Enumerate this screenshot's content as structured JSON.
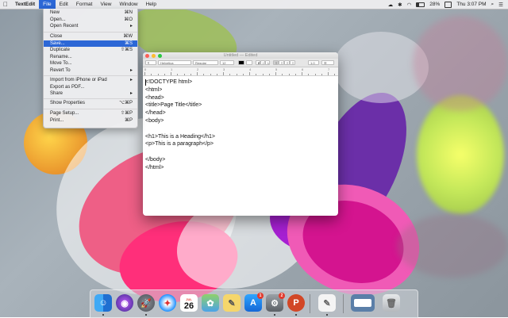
{
  "menubar": {
    "app_name": "TextEdit",
    "menus": [
      "File",
      "Edit",
      "Format",
      "View",
      "Window",
      "Help"
    ],
    "battery": "28%",
    "clock": "Thu 3:07 PM",
    "battery_level": 0.28
  },
  "file_menu": {
    "items": [
      {
        "label": "New",
        "shortcut": "⌘N"
      },
      {
        "label": "Open...",
        "shortcut": "⌘O"
      },
      {
        "label": "Open Recent",
        "shortcut": "▸"
      },
      {
        "label": "Close",
        "shortcut": "⌘W"
      },
      {
        "label": "Save...",
        "shortcut": "⌘S"
      },
      {
        "label": "Duplicate",
        "shortcut": "⇧⌘S"
      },
      {
        "label": "Rename...",
        "shortcut": ""
      },
      {
        "label": "Move To...",
        "shortcut": ""
      },
      {
        "label": "Revert To",
        "shortcut": "▸"
      },
      {
        "label": "Import from iPhone or iPad",
        "shortcut": "▸"
      },
      {
        "label": "Export as PDF...",
        "shortcut": ""
      },
      {
        "label": "Share",
        "shortcut": "▸"
      },
      {
        "label": "Show Properties",
        "shortcut": "⌥⌘P"
      },
      {
        "label": "Page Setup...",
        "shortcut": "⇧⌘P"
      },
      {
        "label": "Print...",
        "shortcut": "⌘P"
      }
    ]
  },
  "window": {
    "title": "Untitled",
    "edited": "— Edited",
    "toolbar": {
      "style": "¶",
      "font": "Helvetica",
      "weight": "Regular",
      "size": "12",
      "spacing": "1.0"
    },
    "ruler": [
      "0",
      "1",
      "2",
      "3",
      "4",
      "5",
      "6",
      "7"
    ],
    "lines": [
      "<!DOCTYPE html>",
      "<html>",
      "<head>",
      "<title>Page Title</title>",
      "</head>",
      "<body>",
      "",
      "<h1>This is a Heading</h1>",
      "<p>This is a paragraph</p>",
      "",
      "</body>",
      "</html>"
    ]
  },
  "dock": {
    "calendar_month": "JUL",
    "calendar_day": "26",
    "appstore_badge": "1",
    "prefs_badge": "2",
    "powerpoint_letter": "P"
  },
  "colors": {
    "menu_highlight": "#2c67d6",
    "close": "#fc5f57",
    "minimize": "#fdbc2e",
    "zoom": "#29c840"
  }
}
